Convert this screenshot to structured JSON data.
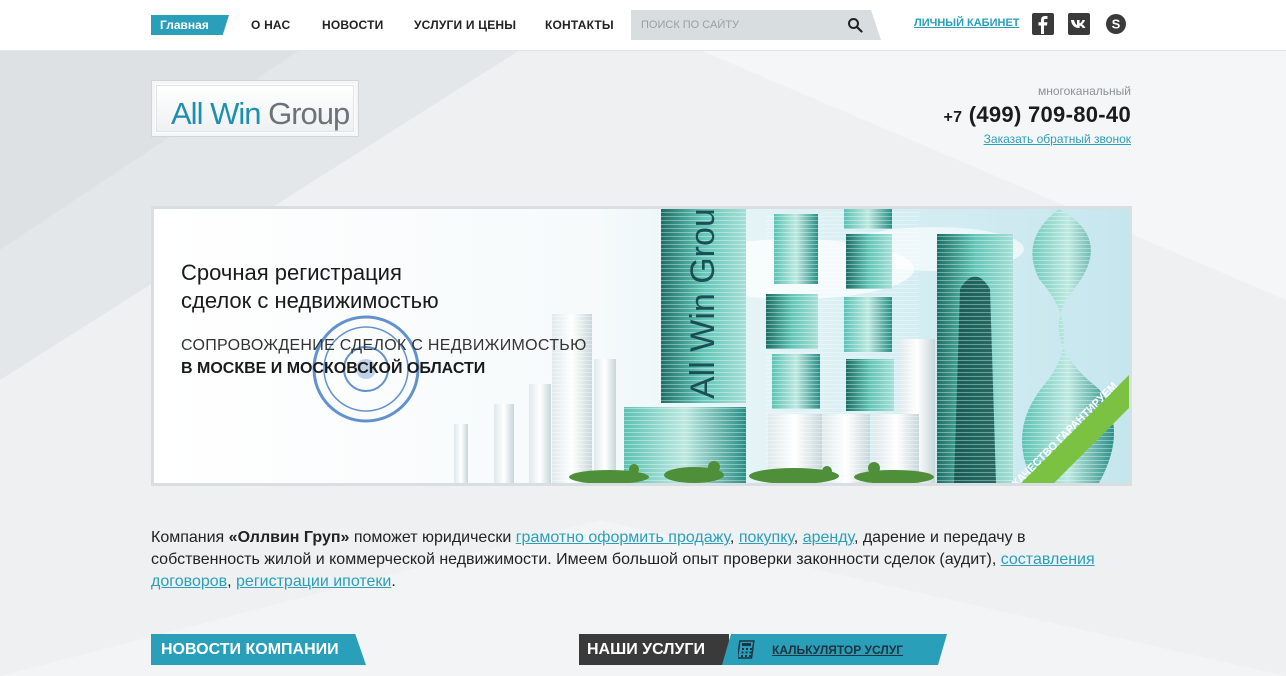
{
  "nav": {
    "items": [
      {
        "label": "Главная",
        "active": true
      },
      {
        "label": "О нас"
      },
      {
        "label": "Новости"
      },
      {
        "label": "Услуги и цены"
      },
      {
        "label": "Контакты"
      }
    ],
    "search_placeholder": "ПОИСК ПО САЙТУ",
    "search_icon": "magnifier",
    "cabinet_label": "Личный кабинет",
    "social": [
      "facebook-icon",
      "vk-icon",
      "skype-icon"
    ]
  },
  "header": {
    "logo_part1": "All Win",
    "logo_part2": "Group",
    "phone_note": "многоканальный",
    "phone_prefix": "+7",
    "phone_number": "(499) 709-80-40",
    "callback_label": "Заказать обратный звонок"
  },
  "banner": {
    "title_line1": "Срочная регистрация",
    "title_line2": "сделок с недвижимостью",
    "subtitle_line1": "СОПРОВОЖДЕНИЕ СДЕЛОК С НЕДВИЖИМОСТЬЮ",
    "subtitle_line2": "В МОСКВЕ И МОСКОВСКОЙ ОБЛАСТИ",
    "ribbon": "Качество гарантируем",
    "tower_label": "All Win Group"
  },
  "intro": {
    "t1": "Компания ",
    "company": "«Оллвин Груп»",
    "t2": " поможет юридически ",
    "link_sale": "грамотно оформить продажу",
    "t3": ", ",
    "link_buy": "покупку",
    "t4": ", ",
    "link_rent": "аренду",
    "t5": ", дарение и передачу в собственность жилой и коммерческой недвижимости. Имеем большой опыт проверки законности сделок (аудит), ",
    "link_contracts": "составления договоров",
    "t6": ", ",
    "link_mortgage": "регистрации ипотеки",
    "t7": "."
  },
  "sections": {
    "news": "Новости компании",
    "services": "Наши услуги",
    "calculator": "Калькулятор услуг"
  },
  "colors": {
    "accent": "#2a9fba",
    "dark": "#3a3a3a",
    "ribbon": "#7cc242"
  }
}
